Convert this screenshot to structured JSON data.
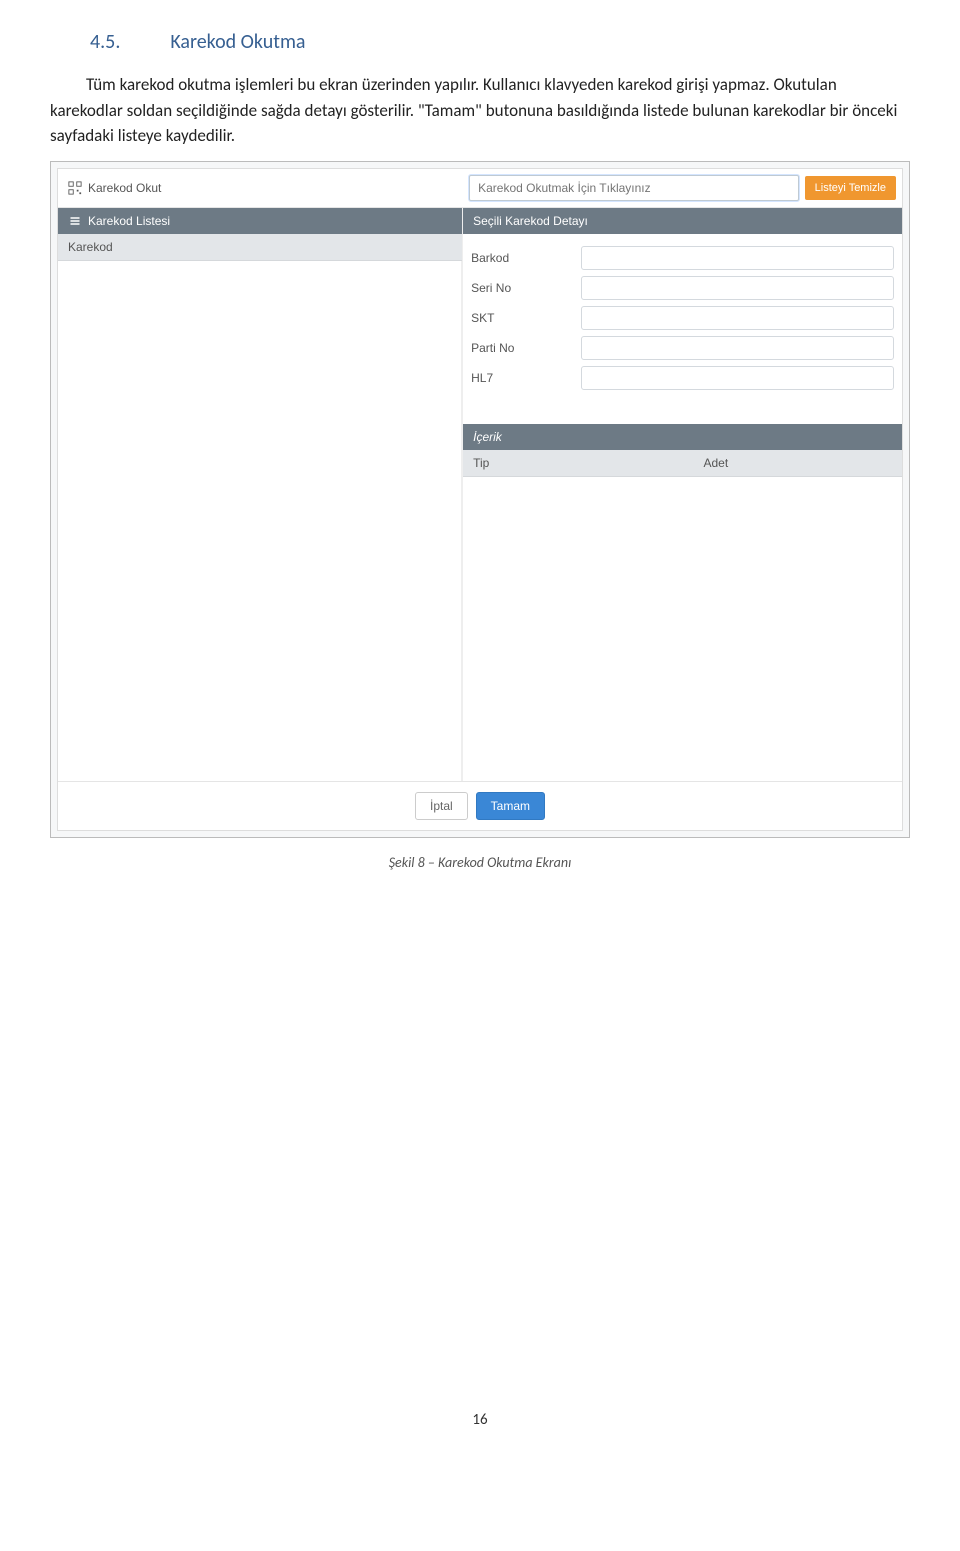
{
  "heading": {
    "number": "4.5.",
    "title": "Karekod Okutma"
  },
  "paragraph": {
    "s1": "Tüm karekod okutma işlemleri bu ekran üzerinden yapılır. Kullanıcı klavyeden karekod girişi yapmaz. Okutulan karekodlar soldan seçildiğinde sağda detayı gösterilir. \"Tamam\" butonuna basıldığında listede bulunan karekodlar bir önceki sayfadaki listeye kaydedilir."
  },
  "ui": {
    "top": {
      "scan_label": "Karekod Okut",
      "scan_placeholder": "Karekod Okutmak İçin Tıklayınız",
      "clear_button": "Listeyi Temizle"
    },
    "left": {
      "list_title": "Karekod Listesi",
      "col_header": "Karekod"
    },
    "right": {
      "detail_title": "Seçili Karekod Detayı",
      "fields": {
        "barkod": "Barkod",
        "serino": "Seri No",
        "skt": "SKT",
        "partino": "Parti No",
        "hl7": "HL7"
      },
      "content_title": "İçerik",
      "content_cols": {
        "tip": "Tip",
        "adet": "Adet"
      }
    },
    "footer": {
      "cancel": "İptal",
      "ok": "Tamam"
    }
  },
  "caption": "Şekil 8 – Karekod Okutma Ekranı",
  "page_number": "16"
}
